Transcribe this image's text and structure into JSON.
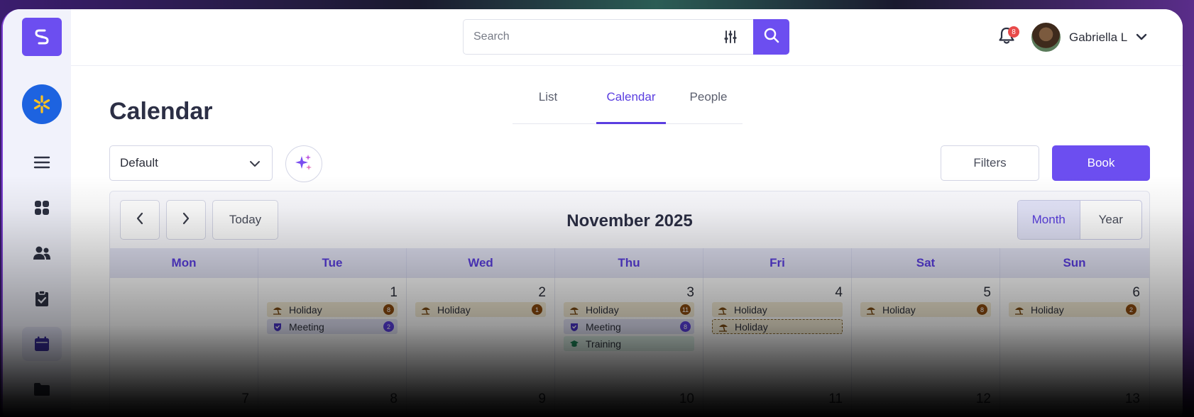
{
  "search": {
    "placeholder": "Search"
  },
  "notifications": {
    "count": "8"
  },
  "user": {
    "name": "Gabriella L"
  },
  "page": {
    "title": "Calendar"
  },
  "tabs": [
    {
      "label": "List",
      "active": false
    },
    {
      "label": "Calendar",
      "active": true
    },
    {
      "label": "People",
      "active": false
    }
  ],
  "view_select": {
    "value": "Default"
  },
  "actions": {
    "filters_label": "Filters",
    "book_label": "Book"
  },
  "calendar": {
    "today_label": "Today",
    "month_title": "November 2025",
    "view_modes": [
      {
        "label": "Month",
        "active": true
      },
      {
        "label": "Year",
        "active": false
      }
    ],
    "weekdays": [
      "Mon",
      "Tue",
      "Wed",
      "Thu",
      "Fri",
      "Sat",
      "Sun"
    ],
    "week1": [
      {
        "day": "",
        "events": []
      },
      {
        "day": "1",
        "events": [
          {
            "type": "holiday",
            "label": "Holiday",
            "count": "8"
          },
          {
            "type": "meeting",
            "label": "Meeting",
            "count": "2"
          }
        ]
      },
      {
        "day": "2",
        "events": [
          {
            "type": "holiday",
            "label": "Holiday",
            "count": "1"
          }
        ]
      },
      {
        "day": "3",
        "events": [
          {
            "type": "holiday",
            "label": "Holiday",
            "count": "11"
          },
          {
            "type": "meeting",
            "label": "Meeting",
            "count": "8"
          },
          {
            "type": "training",
            "label": "Training",
            "count": ""
          }
        ]
      },
      {
        "day": "4",
        "events": [
          {
            "type": "holiday",
            "label": "Holiday",
            "count": ""
          },
          {
            "type": "dashed",
            "label": "Holiday",
            "count": ""
          }
        ]
      },
      {
        "day": "5",
        "events": [
          {
            "type": "holiday",
            "label": "Holiday",
            "count": "8"
          }
        ]
      },
      {
        "day": "6",
        "events": [
          {
            "type": "holiday",
            "label": "Holiday",
            "count": "2"
          }
        ]
      }
    ],
    "week2_days": [
      "7",
      "8",
      "9",
      "10",
      "11",
      "12",
      "13"
    ]
  },
  "colors": {
    "accent": "#6c4ef0",
    "brand_blue": "#1d63e0",
    "holiday_bg": "#f4ecd6",
    "meeting_bg": "#e2e3f6",
    "training_bg": "#e0f3ea"
  },
  "icons": [
    "logo-icon",
    "brand-spark-icon",
    "menu-icon",
    "dashboard-icon",
    "people-icon",
    "clipboard-icon",
    "calendar-icon",
    "folder-icon",
    "sliders-icon",
    "search-icon",
    "bell-icon",
    "chevron-down-icon",
    "sparkles-icon",
    "chevron-left-icon",
    "chevron-right-icon",
    "umbrella-icon",
    "shield-icon",
    "graduation-icon"
  ]
}
